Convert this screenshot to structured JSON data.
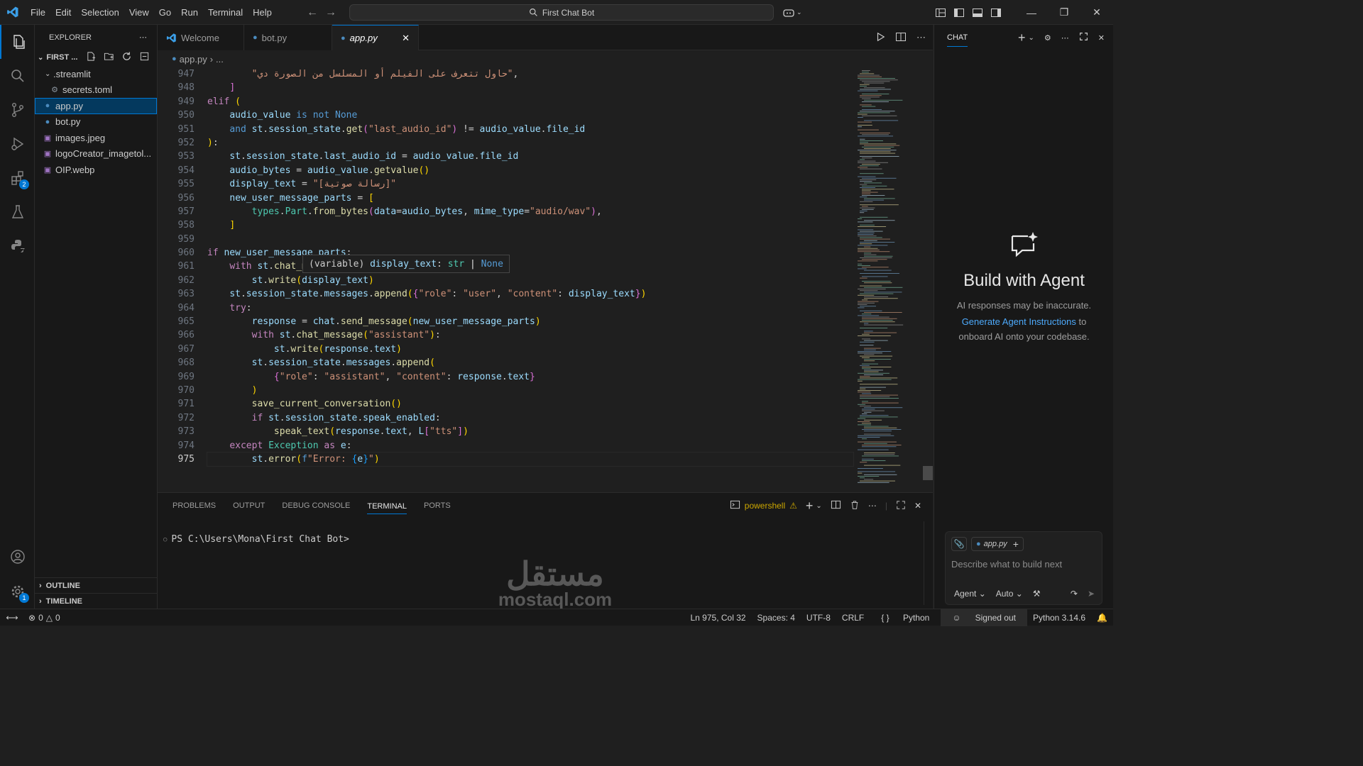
{
  "titlebar": {
    "menu": [
      "File",
      "Edit",
      "Selection",
      "View",
      "Go",
      "Run",
      "Terminal",
      "Help"
    ],
    "command_center": "First Chat Bot"
  },
  "sidebar": {
    "title": "EXPLORER",
    "folder": "FIRST ...",
    "items": [
      {
        "label": ".streamlit",
        "type": "folder"
      },
      {
        "label": "secrets.toml",
        "type": "toml"
      },
      {
        "label": "app.py",
        "type": "python"
      },
      {
        "label": "bot.py",
        "type": "python"
      },
      {
        "label": "images.jpeg",
        "type": "image"
      },
      {
        "label": "logoCreator_imagetol...",
        "type": "image"
      },
      {
        "label": "OIP.webp",
        "type": "image"
      }
    ],
    "outline": "OUTLINE",
    "timeline": "TIMELINE"
  },
  "activitybar": {
    "extensions_badge": "2",
    "settings_badge": "1"
  },
  "tabs": [
    {
      "label": "Welcome"
    },
    {
      "label": "bot.py"
    },
    {
      "label": "app.py"
    }
  ],
  "breadcrumb": {
    "file": "app.py",
    "rest": "..."
  },
  "editor": {
    "line_numbers": [
      "947",
      "948",
      "949",
      "950",
      "951",
      "952",
      "953",
      "954",
      "955",
      "956",
      "957",
      "958",
      "959",
      "960",
      "961",
      "962",
      "963",
      "964",
      "965",
      "966",
      "967",
      "968",
      "969",
      "970",
      "971",
      "972",
      "973",
      "974",
      "975"
    ],
    "current_line": "975",
    "hover": {
      "kind": "(variable)",
      "name": "display_text",
      "colon": ":",
      "type": "str",
      "pipe": "|",
      "none": "None"
    }
  },
  "panel": {
    "tabs": [
      "PROBLEMS",
      "OUTPUT",
      "DEBUG CONSOLE",
      "TERMINAL",
      "PORTS"
    ],
    "active_tab": "TERMINAL",
    "shell": "powershell",
    "prompt": "PS C:\\Users\\Mona\\First Chat Bot>"
  },
  "watermark": {
    "arabic": "مستقل",
    "latin": "mostaql.com"
  },
  "chat": {
    "header": "CHAT",
    "title": "Build with Agent",
    "disclaimer": "AI responses may be inaccurate.",
    "link": "Generate Agent Instructions",
    "link_tail": " to onboard AI onto your codebase.",
    "chip": "app.py",
    "placeholder": "Describe what to build next",
    "mode": "Agent",
    "model": "Auto"
  },
  "statusbar": {
    "errors": "0",
    "warnings": "0",
    "position": "Ln 975, Col 32",
    "spaces": "Spaces: 4",
    "encoding": "UTF-8",
    "eol": "CRLF",
    "language": "Python",
    "account": "Signed out",
    "interpreter": "Python 3.14.6"
  },
  "colors": {
    "accent": "#0078d4",
    "keyword": "#569cd6",
    "string": "#ce9178",
    "function": "#dcdcaa",
    "variable": "#9cdcfe"
  }
}
